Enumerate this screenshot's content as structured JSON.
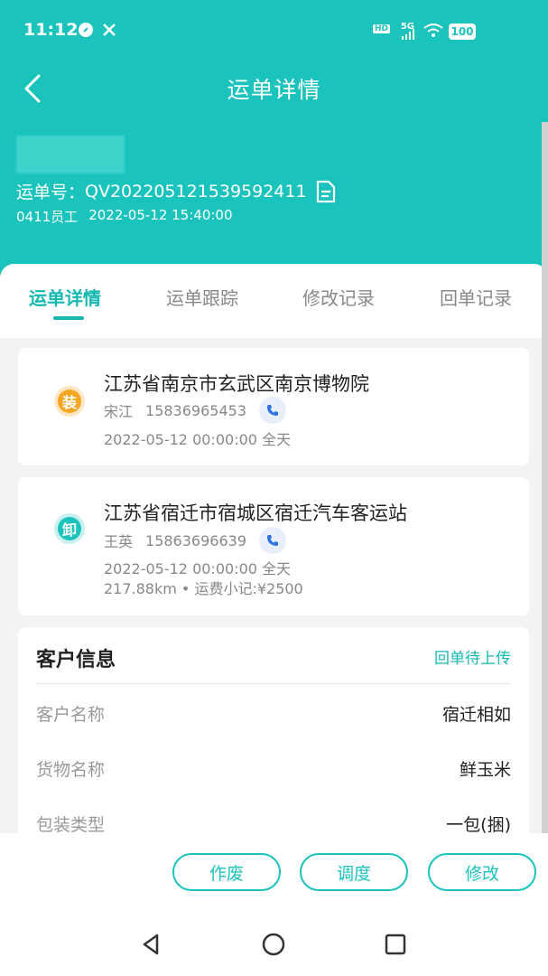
{
  "status_bar": {
    "time": "11:12",
    "battery": "100",
    "network": "5G",
    "hd": "HD"
  },
  "header": {
    "title": "运单详情",
    "waybill_label": "运单号：",
    "waybill_no": "QV20220512153959​2411",
    "operator": "0411员工",
    "created_at": "2022-05-12 15:40:00"
  },
  "tabs": [
    {
      "label": "运单详情"
    },
    {
      "label": "运单跟踪"
    },
    {
      "label": "修改记录"
    },
    {
      "label": "回单记录"
    }
  ],
  "load": {
    "badge": "装",
    "address": "江苏省南京市玄武区南京博物院",
    "contact_name": "宋江",
    "phone": "15836965453",
    "datetime": "2022-05-12 00:00:00 全天"
  },
  "unload": {
    "badge": "卸",
    "address": "江苏省宿迁市宿城区宿迁汽车客运站",
    "contact_name": "王英",
    "phone": "15863696639",
    "datetime": "2022-05-12 00:00:00 全天",
    "distance_fee": "217.88km • 运费小记:¥2500"
  },
  "customer": {
    "title": "客户信息",
    "receipt_status": "回单待上传",
    "rows": [
      {
        "key": "客户名称",
        "value": "宿迁相如"
      },
      {
        "key": "货物名称",
        "value": "鲜玉米"
      },
      {
        "key": "包装类型",
        "value": "一包(捆)"
      }
    ]
  },
  "actions": {
    "void_label": "作废",
    "dispatch_label": "调度",
    "edit_label": "修改"
  },
  "colors": {
    "accent": "#1bc3bd",
    "load_badge": "#f5a623",
    "unload_badge": "#1bc3bd"
  }
}
